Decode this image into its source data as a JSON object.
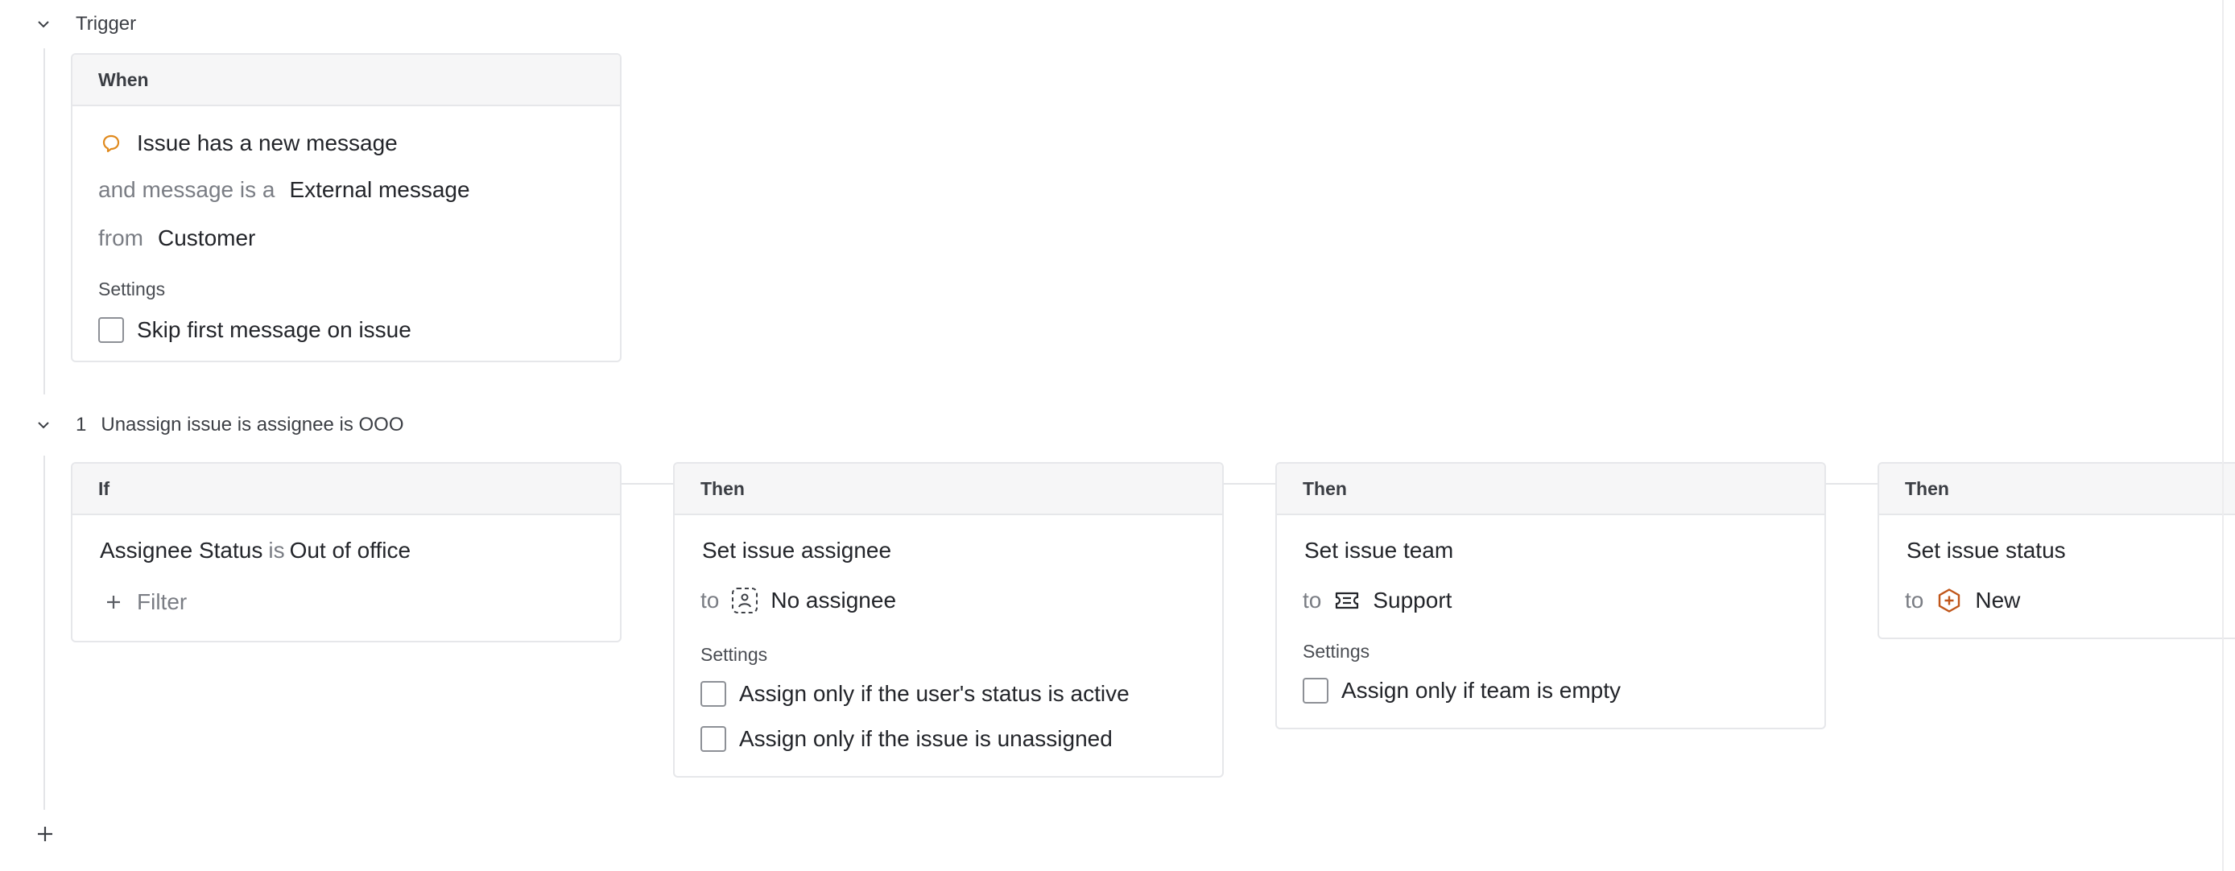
{
  "trigger": {
    "title": "Trigger",
    "card_header": "When",
    "event": "Issue has a new message",
    "message_type_prefix": "and message is a",
    "message_type": "External message",
    "from_prefix": "from",
    "from_value": "Customer",
    "settings_label": "Settings",
    "setting_skip_first": "Skip first message on issue"
  },
  "rule": {
    "number": "1",
    "title": "Unassign issue is assignee is OOO",
    "if_card": {
      "header": "If",
      "condition_field": "Assignee Status",
      "condition_op": "is",
      "condition_value": "Out of office",
      "filter_label": "Filter"
    },
    "then_assignee": {
      "header": "Then",
      "action": "Set issue assignee",
      "to_prefix": "to",
      "value": "No assignee",
      "settings_label": "Settings",
      "setting_active": "Assign only if the user's status is active",
      "setting_unassigned": "Assign only if the issue is unassigned"
    },
    "then_team": {
      "header": "Then",
      "action": "Set issue team",
      "to_prefix": "to",
      "value": "Support",
      "settings_label": "Settings",
      "setting_empty": "Assign only if team is empty"
    },
    "then_status": {
      "header": "Then",
      "action": "Set issue status",
      "to_prefix": "to",
      "value": "New"
    }
  },
  "colors": {
    "message_icon": "#e08a1e",
    "status_new_icon": "#c0561a",
    "border": "#e6e7ea",
    "header_bg": "#f6f6f7"
  },
  "icons": [
    "chevron-down-icon",
    "message-bubble-icon",
    "no-assignee-icon",
    "team-ticket-icon",
    "status-new-icon",
    "plus-icon"
  ]
}
